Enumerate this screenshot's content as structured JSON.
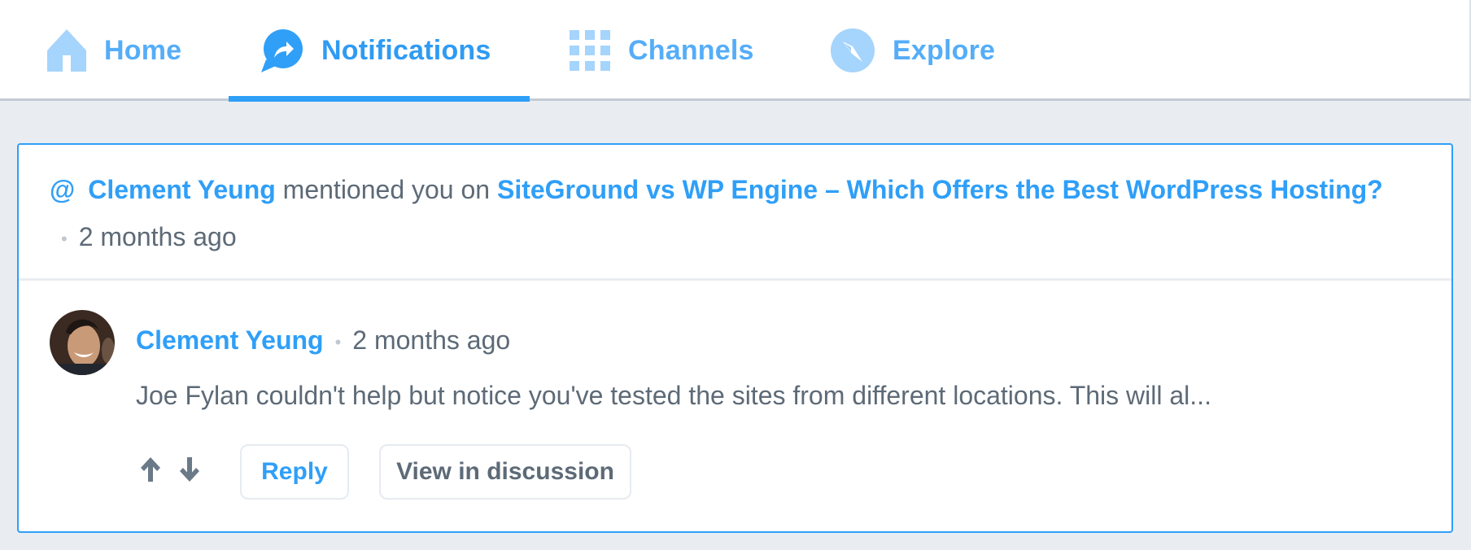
{
  "nav": {
    "tabs": [
      {
        "id": "home",
        "label": "Home",
        "icon": "home-icon",
        "active": false
      },
      {
        "id": "notifications",
        "label": "Notifications",
        "icon": "share-bubble-icon",
        "active": true
      },
      {
        "id": "channels",
        "label": "Channels",
        "icon": "grid-icon",
        "active": false
      },
      {
        "id": "explore",
        "label": "Explore",
        "icon": "compass-icon",
        "active": false
      }
    ]
  },
  "notification": {
    "at_symbol": "@",
    "actor": "Clement Yeung",
    "action_text": " mentioned you on ",
    "post_title": "SiteGround vs WP Engine – Which Offers the Best WordPress Hosting?",
    "separator": "•",
    "time": "2 months ago",
    "comment": {
      "author": "Clement Yeung",
      "separator": "•",
      "time": "2 months ago",
      "text": "Joe Fylan couldn't help but notice you've tested the sites from different locations. This will al...",
      "actions": {
        "upvote_icon": "arrow-up-icon",
        "downvote_icon": "arrow-down-icon",
        "reply_label": "Reply",
        "view_label": "View in discussion"
      }
    }
  },
  "colors": {
    "accent": "#2f9ff8",
    "accent_light": "#a5d4fc",
    "text": "#5d6a77",
    "background": "#e9edf2"
  }
}
